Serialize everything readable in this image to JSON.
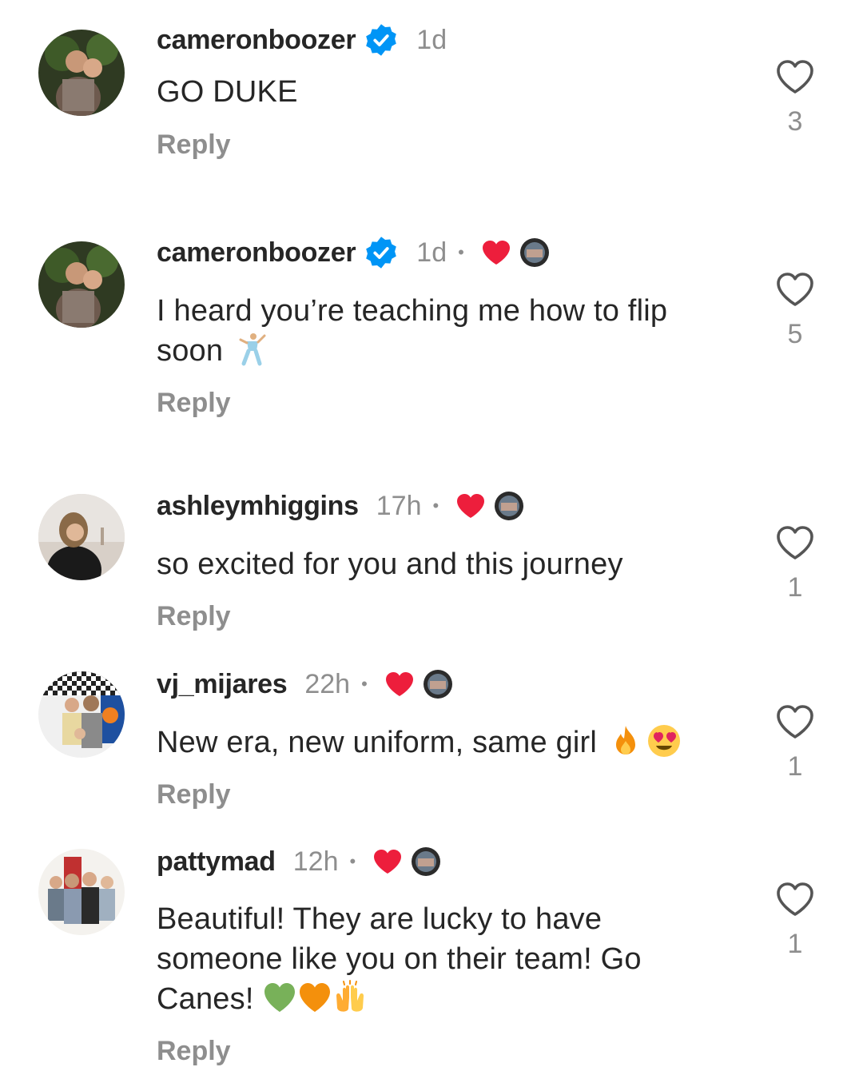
{
  "comments": [
    {
      "username": "cameronboozer",
      "verified": true,
      "time": "1d",
      "liked_by_author": false,
      "text": "GO DUKE",
      "emoji": [],
      "reply": "Reply",
      "likes": "3"
    },
    {
      "username": "cameronboozer",
      "verified": true,
      "time": "1d",
      "liked_by_author": true,
      "text": "I heard you’re teaching me how to flip soon",
      "emoji": [
        "dancing-man-emoji"
      ],
      "reply": "Reply",
      "likes": "5"
    },
    {
      "username": "ashleymhiggins",
      "verified": false,
      "time": "17h",
      "liked_by_author": true,
      "text": "so excited for you and this journey",
      "emoji": [],
      "reply": "Reply",
      "likes": "1"
    },
    {
      "username": "vj_mijares",
      "verified": false,
      "time": "22h",
      "liked_by_author": true,
      "text": "New era, new uniform, same girl",
      "emoji": [
        "fire-emoji",
        "heart-eyes-emoji"
      ],
      "reply": "Reply",
      "likes": "1"
    },
    {
      "username": "pattymad",
      "verified": false,
      "time": "12h",
      "liked_by_author": true,
      "text": "Beautiful! They are lucky to have someone like you on their team! Go Canes!",
      "emoji": [
        "green-heart-emoji",
        "orange-heart-emoji",
        "raising-hands-emoji"
      ],
      "reply": "Reply",
      "likes": "1"
    }
  ],
  "colors": {
    "text": "#262626",
    "muted": "#8e8e8e",
    "verified_blue": "#0095f6",
    "like_red": "#ed1e3c"
  }
}
